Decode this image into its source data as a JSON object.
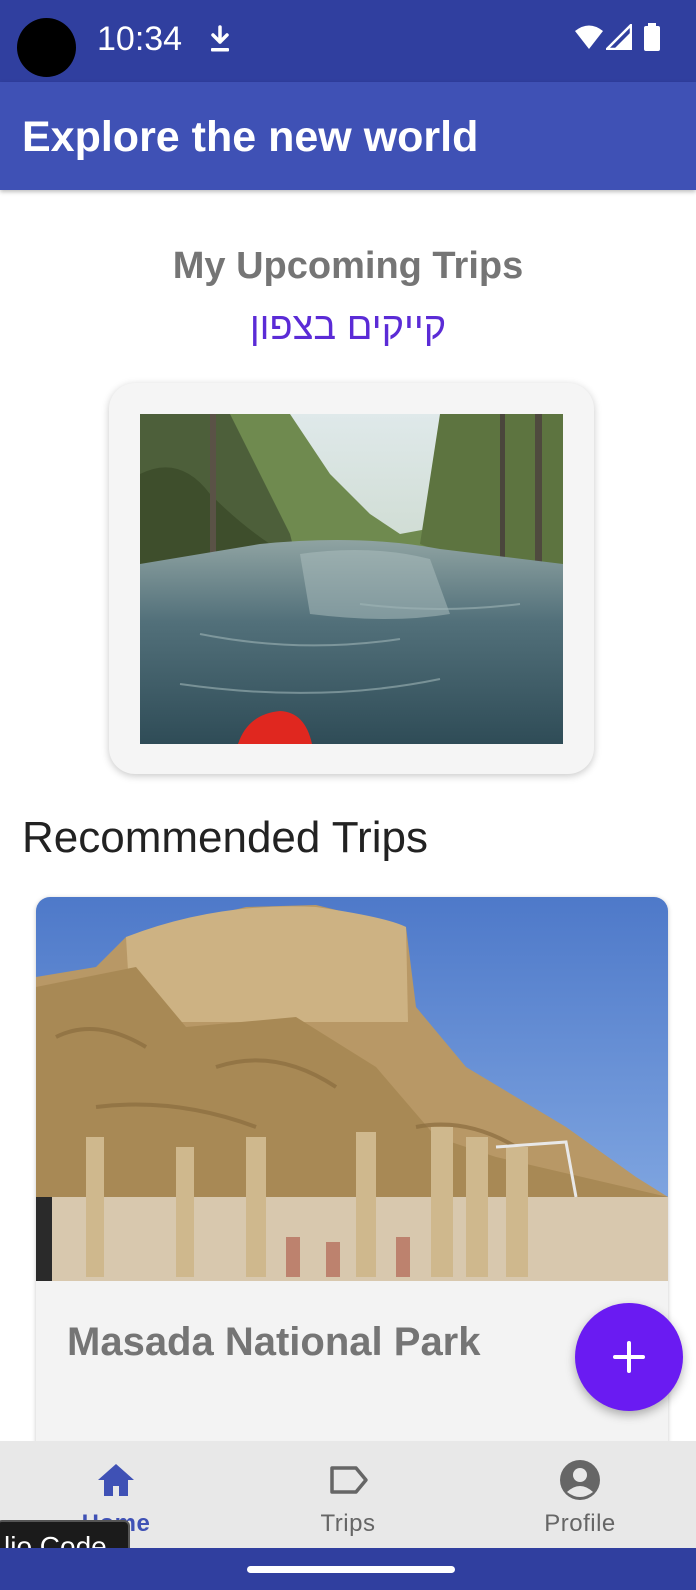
{
  "status_bar": {
    "time": "10:34",
    "icons": [
      "download-icon",
      "wifi-icon",
      "signal-icon",
      "battery-icon"
    ]
  },
  "app_bar": {
    "title": "Explore the new world"
  },
  "upcoming": {
    "heading": "My Upcoming Trips",
    "trip_name": "קייקים בצפון",
    "image_desc": "river-kayak-photo"
  },
  "recommended": {
    "heading": "Recommended Trips",
    "items": [
      {
        "title": "Masada National Park",
        "image_desc": "masada-ruins-photo"
      }
    ]
  },
  "fab": {
    "icon": "plus-icon"
  },
  "bottom_nav": {
    "items": [
      {
        "label": "Home",
        "icon": "home-icon",
        "active": true
      },
      {
        "label": "Trips",
        "icon": "label-tag-icon",
        "active": false
      },
      {
        "label": "Profile",
        "icon": "account-circle-icon",
        "active": false
      }
    ]
  },
  "tooltip": {
    "text": "lio Code"
  },
  "colors": {
    "status_bar": "#303f9f",
    "app_bar": "#3f51b5",
    "accent_purple": "#6a1bf2",
    "trip_name": "#5b2bd6",
    "nav_background": "#e8e8e8"
  }
}
